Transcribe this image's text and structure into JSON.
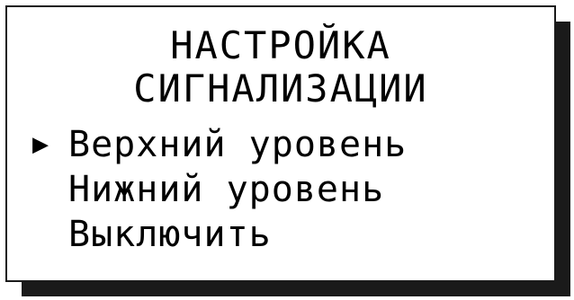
{
  "screen": {
    "title_line1": "НАСТРОЙКА",
    "title_line2": "СИГНАЛИЗАЦИИ"
  },
  "menu": {
    "cursor_glyph": "▶",
    "selected_index": 0,
    "items": [
      {
        "label": "Верхний уровень"
      },
      {
        "label": "Нижний уровень"
      },
      {
        "label": "Выключить"
      }
    ]
  },
  "colors": {
    "screen_background": "#ffffff",
    "text": "#000000",
    "shadow": "#1a1a1a"
  }
}
